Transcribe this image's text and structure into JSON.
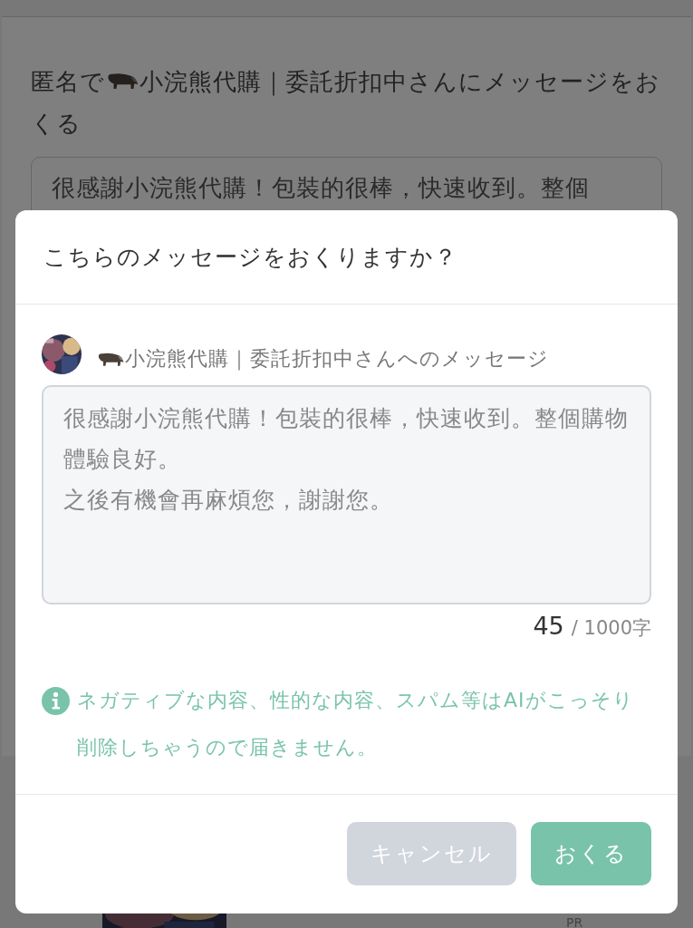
{
  "background": {
    "title_prefix": "匿名で",
    "title_rest": "小浣熊代購｜委託折扣中さんにメッセージをおくる",
    "message": "很感謝小浣熊代購！包裝的很棒，快速收到。整個",
    "tag": "PR"
  },
  "dialog": {
    "title": "こちらのメッセージをおくりますか？",
    "recipient": "小浣熊代購｜委託折扣中さんへのメッセージ",
    "message_lines": [
      "很感謝小浣熊代購！包裝的很棒，快速收到。整個購物體驗良好。",
      "之後有機會再麻煩您，謝謝您。"
    ],
    "count": "45",
    "limit": "/ 1000字",
    "notice": "ネガティブな内容、性的な内容、スパム等はAIがこっそり削除しちゃうので届きません。",
    "buttons": [
      {
        "label": "キャンセル",
        "kind": "cancel"
      },
      {
        "label": "おくる",
        "kind": "primary"
      }
    ]
  }
}
